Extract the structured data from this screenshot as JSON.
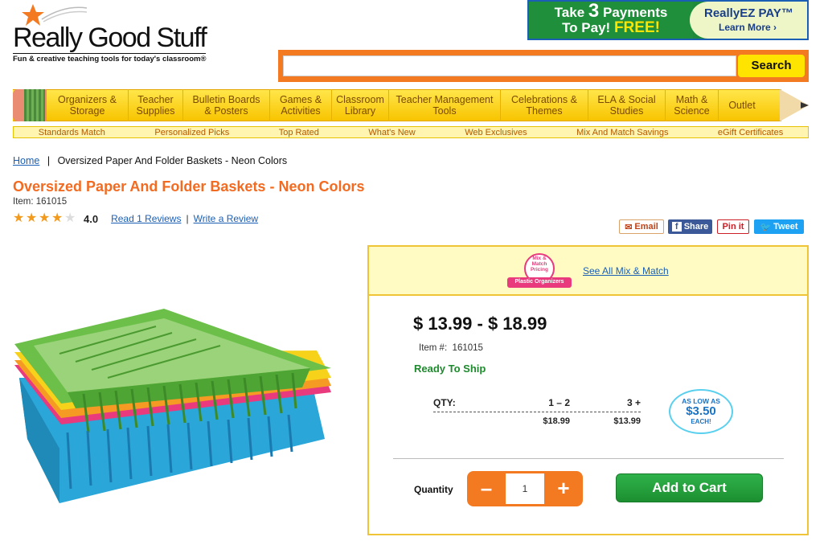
{
  "logo": {
    "name": "Really Good Stuff",
    "tagline": "Fun & creative teaching tools for today's classroom®"
  },
  "promo": {
    "line1": "Take",
    "number": "3",
    "line1b": "Payments",
    "line2": "To Pay!",
    "free": "FREE!",
    "brand": "ReallyEZ PAY™",
    "learn": "Learn More ›"
  },
  "search": {
    "placeholder": "",
    "button": "Search"
  },
  "nav": {
    "items": [
      {
        "label": "Organizers & Storage"
      },
      {
        "label": "Teacher Supplies"
      },
      {
        "label": "Bulletin Boards & Posters"
      },
      {
        "label": "Games & Activities"
      },
      {
        "label": "Classroom Library"
      },
      {
        "label": "Teacher Management Tools"
      },
      {
        "label": "Celebrations & Themes"
      },
      {
        "label": "ELA & Social Studies"
      },
      {
        "label": "Math & Science"
      },
      {
        "label": "Outlet"
      }
    ],
    "sub": [
      "Standards Match",
      "Personalized Picks",
      "Top Rated",
      "What's New",
      "Web Exclusives",
      "Mix And Match Savings",
      "eGift Certificates"
    ]
  },
  "breadcrumb": {
    "home": "Home",
    "sep": "|",
    "current": "Oversized Paper And Folder Baskets - Neon Colors"
  },
  "product": {
    "title": "Oversized Paper And Folder Baskets - Neon Colors",
    "item_label": "Item: 161015",
    "rating": 4.0,
    "rating_text": "4.0",
    "reviews_link": "Read 1 Reviews",
    "write_review": "Write a Review"
  },
  "share": {
    "email": "Email",
    "facebook": "Share",
    "pinterest": "Pin it",
    "twitter": "Tweet"
  },
  "panel": {
    "mix_badge": {
      "line1": "Mix &",
      "line2": "Match",
      "line3": "Pricing",
      "ribbon": "Plastic Organizers"
    },
    "see_all": "See All Mix & Match",
    "price": "$ 13.99 - $ 18.99",
    "item_label": "Item #:",
    "item_no": "161015",
    "ship": "Ready To Ship",
    "qty_header": "QTY:",
    "tier1": "1 – 2",
    "tier2": "3 +",
    "price1": "$18.99",
    "price2": "$13.99",
    "low": {
      "l1": "AS LOW AS",
      "l2": "$3.50",
      "l3": "EACH!"
    },
    "quantity_label": "Quantity",
    "quantity_value": "1",
    "minus": "–",
    "plus": "+",
    "add_to_cart": "Add to Cart"
  },
  "colors": {
    "accent": "#f26b21",
    "nav_yellow": "#ffd400",
    "cart_green": "#1e9a35",
    "link": "#1a5fb4"
  }
}
